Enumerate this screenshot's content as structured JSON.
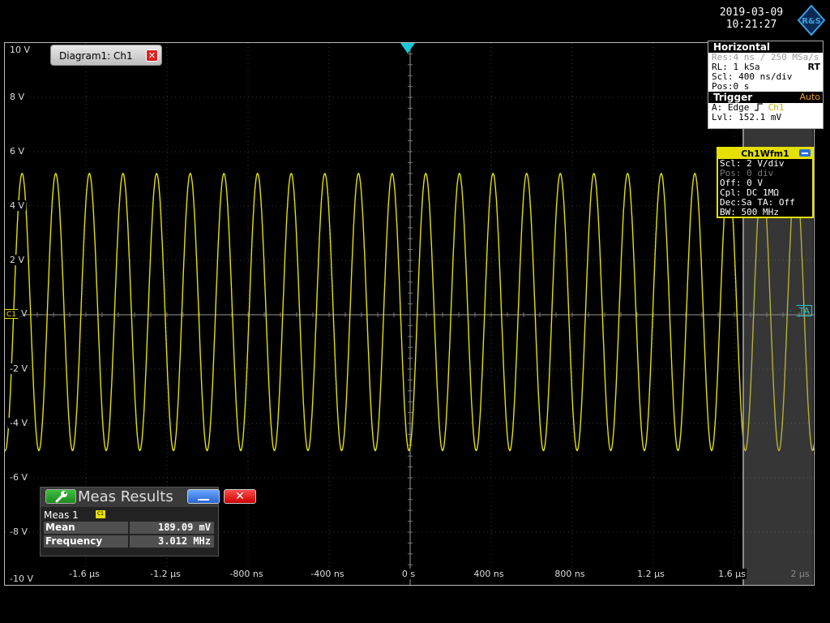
{
  "datetime": {
    "date": "2019-03-09",
    "time": "10:21:27"
  },
  "brand_logo_text": "R&S",
  "diagram": {
    "title": "Diagram1: Ch1"
  },
  "y_axis_labels": [
    "10 V",
    "8 V",
    "6 V",
    "4 V",
    "2 V",
    "-2 V",
    "-4 V",
    "-6 V",
    "-8 V",
    "-10 V"
  ],
  "y_zero_label": "V",
  "c1_marker": "C1",
  "ta_marker": "TA",
  "x_axis_labels": [
    "-1.6 µs",
    "-1.2 µs",
    "-800 ns",
    "-400 ns",
    "0 s",
    "400 ns",
    "800 ns",
    "1.2 µs",
    "1.6 µs",
    "2 µs"
  ],
  "horizontal": {
    "header": "Horizontal",
    "res": "Res:4 ns / 250 MSa/s",
    "rl": "RL: 1 kSa",
    "mode": "RT",
    "scl": "Scl: 400 ns/div",
    "pos": "Pos:0 s"
  },
  "trigger": {
    "header": "Trigger",
    "mode": "Auto",
    "type_prefix": "A:  Edge ",
    "source": "Ch1",
    "level": "Lvl: 152.1 mV"
  },
  "channel": {
    "title": "Ch1Wfm1",
    "scl": "Scl: 2 V/div",
    "pos": "Pos: 0 div",
    "off": "Off: 0 V",
    "cpl": "Cpl: DC 1MΩ",
    "dec": "Dec:Sa   TA: Off",
    "bw": "BW: 500 MHz",
    "color": "#e5e000"
  },
  "measurement": {
    "title": "Meas Results",
    "label": "Meas 1",
    "source_badge": "C1",
    "rows": [
      {
        "name": "Mean",
        "value": "189.09 mV"
      },
      {
        "name": "Frequency",
        "value": "3.012 MHz"
      }
    ]
  },
  "chart_data": {
    "type": "line",
    "title": "",
    "xlabel": "",
    "ylabel": "",
    "xlim_us": [
      -2.0,
      2.0
    ],
    "ylim": [
      -10,
      10
    ],
    "grid": true,
    "series": [
      {
        "frequency_mhz": 3.012,
        "amplitude_v": 5.2,
        "offset_v": 0.19,
        "color": "#e5e000",
        "x_us": [
          -1.915,
          -1.832,
          -1.749,
          -1.666,
          -1.583,
          -1.5,
          -1.417,
          -1.334,
          -1.251,
          -1.168,
          -1.085,
          -1.002,
          -0.919,
          -0.836,
          -0.753,
          -0.67,
          -0.587,
          -0.504,
          -0.421,
          -0.338,
          -0.255,
          -0.172,
          -0.089,
          -0.006,
          0.077,
          0.16,
          0.243,
          0.326,
          0.409,
          0.492,
          0.575,
          0.658,
          0.741,
          0.824,
          0.907,
          0.99,
          1.073,
          1.156,
          1.239,
          1.322,
          1.405,
          1.488,
          1.571,
          1.654,
          1.737,
          1.82,
          1.903
        ],
        "y_v": [
          5.2,
          -5.0,
          5.2,
          -5.0,
          5.2,
          -5.0,
          5.2,
          -5.0,
          5.2,
          -5.0,
          5.2,
          -5.0,
          5.2,
          -5.0,
          5.2,
          -5.0,
          5.2,
          -5.0,
          5.2,
          -5.0,
          5.2,
          -5.0,
          5.2,
          -5.0,
          5.2,
          -5.0,
          5.2,
          -5.0,
          5.2,
          -5.0,
          5.2,
          -5.0,
          5.2,
          -5.0,
          5.2,
          -5.0,
          5.2,
          -5.0,
          5.2,
          -5.0,
          5.2,
          -5.0,
          5.2,
          -5.0,
          5.2,
          -5.0,
          5.2
        ]
      }
    ]
  },
  "colors": {
    "trace": "#e5e000",
    "trigger_marker": "#19c7d9",
    "grid": "#3a3a3a"
  }
}
